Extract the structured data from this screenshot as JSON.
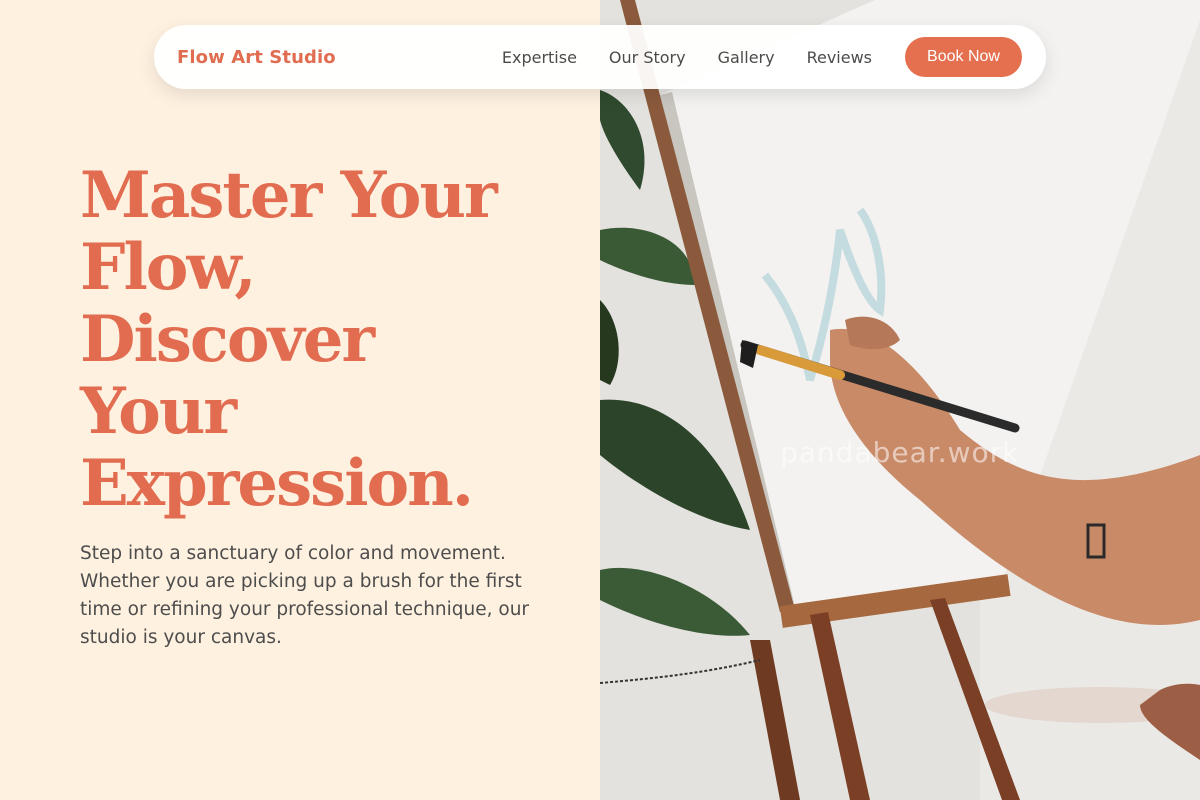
{
  "navbar": {
    "brand": "Flow Art Studio",
    "links": [
      "Expertise",
      "Our Story",
      "Gallery",
      "Reviews"
    ],
    "cta": "Book Now"
  },
  "hero": {
    "title_lines": [
      "Master Your",
      "Flow,",
      "Discover",
      "Your",
      "Expression."
    ],
    "subtitle": "Step into a sanctuary of color and movement. Whether you are picking up a brush for the first time or refining your professional technique, our studio is your canvas."
  },
  "image": {
    "watermark": "pandabear.work"
  },
  "colors": {
    "accent": "#e4704f",
    "background": "#fef1e0",
    "text": "#4d4d4d"
  }
}
